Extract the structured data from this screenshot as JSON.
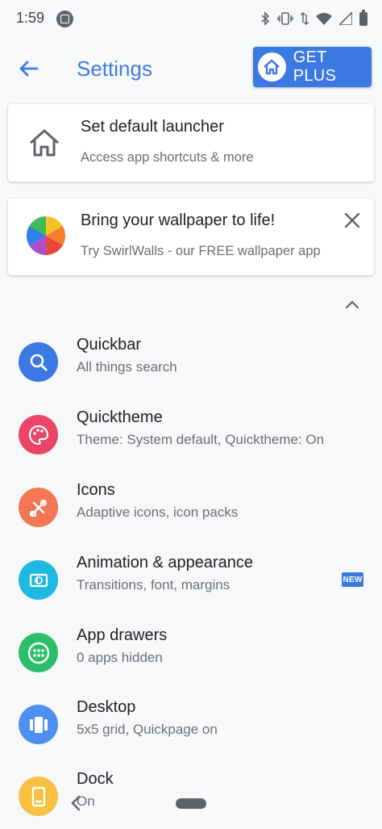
{
  "status_bar": {
    "time": "1:59",
    "icons": [
      "bluetooth-icon",
      "vibrate-icon",
      "data-arrows-icon",
      "wifi-icon",
      "signal-icon",
      "battery-icon"
    ]
  },
  "app_bar": {
    "title": "Settings",
    "get_plus_label": "GET PLUS"
  },
  "cards": [
    {
      "title": "Set default launcher",
      "subtitle": "Access app shortcuts & more",
      "icon": "home-icon"
    },
    {
      "title": "Bring your wallpaper to life!",
      "subtitle": "Try SwirlWalls - our FREE wallpaper app",
      "icon": "swirlwalls-icon"
    }
  ],
  "settings": [
    {
      "title": "Quickbar",
      "subtitle": "All things search",
      "icon": "search-icon",
      "color": "#3b79e2"
    },
    {
      "title": "Quicktheme",
      "subtitle": "Theme: System default, Quicktheme: On",
      "icon": "palette-icon",
      "color": "#ea4466"
    },
    {
      "title": "Icons",
      "subtitle": "Adaptive icons, icon packs",
      "icon": "icons-icon",
      "color": "#f27752"
    },
    {
      "title": "Animation & appearance",
      "subtitle": "Transitions, font, margins",
      "icon": "animation-icon",
      "color": "#1fb8e0",
      "badge": "NEW"
    },
    {
      "title": "App drawers",
      "subtitle": "0 apps hidden",
      "icon": "app-drawer-icon",
      "color": "#2bbf6a"
    },
    {
      "title": "Desktop",
      "subtitle": "5x5 grid, Quickpage on",
      "icon": "desktop-icon",
      "color": "#4f8ff0"
    },
    {
      "title": "Dock",
      "subtitle": "On",
      "icon": "dock-icon",
      "color": "#f7c043"
    }
  ],
  "colors": {
    "accent": "#3b79e2",
    "title": "#3e7be6",
    "background": "#f7f8fa"
  }
}
